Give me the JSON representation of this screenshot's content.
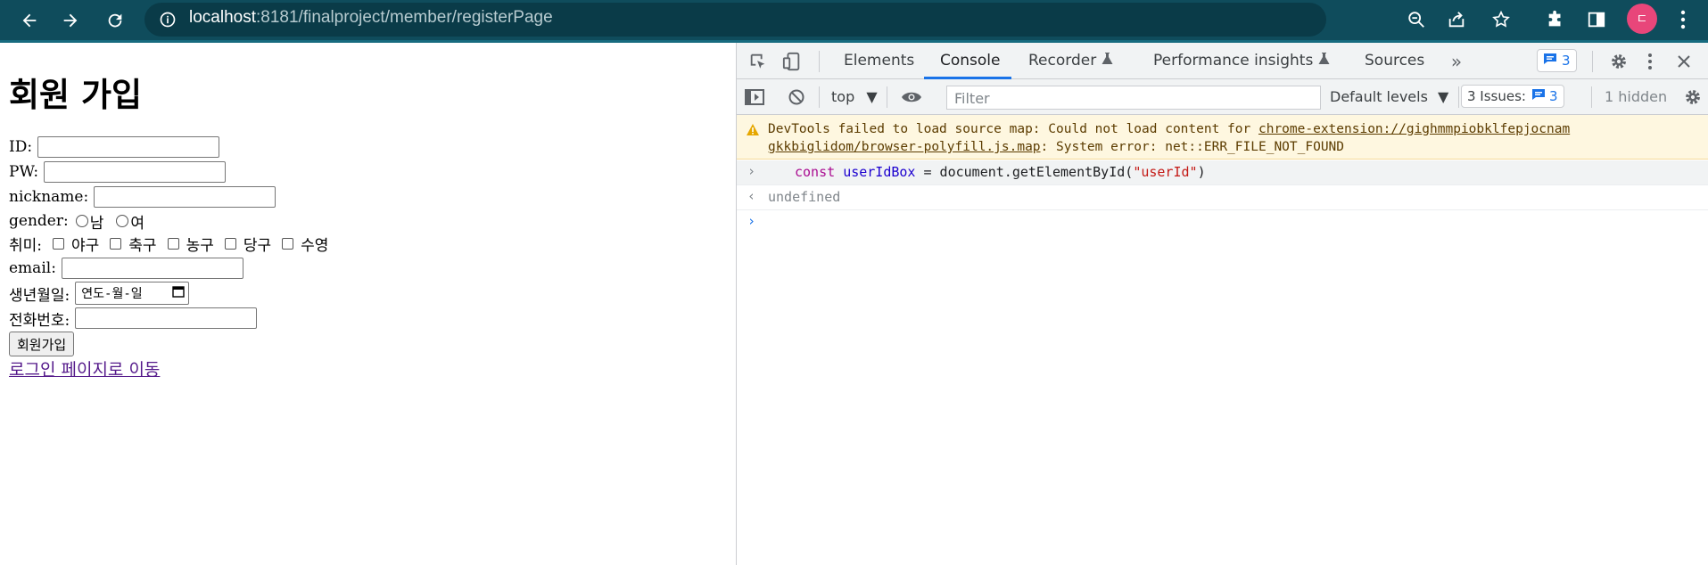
{
  "browser": {
    "url_host": "localhost",
    "url_rest": ":8181/finalproject/member/registerPage",
    "avatar_letter": "ㄷ",
    "colors": {
      "toolbar": "#0f4c5c",
      "avatar": "#e8467a"
    },
    "icons": [
      "back-arrow-icon",
      "forward-arrow-icon",
      "reload-icon",
      "site-info-icon",
      "zoom-icon",
      "share-icon",
      "bookmark-star-icon",
      "extensions-puzzle-icon",
      "side-panel-icon",
      "kebab-menu-icon"
    ]
  },
  "page": {
    "title": "회원 가입",
    "id_label": "ID:",
    "pw_label": "PW:",
    "nickname_label": "nickname:",
    "gender_label": "gender:",
    "gender_options": [
      "남",
      "여"
    ],
    "hobby_label": "취미:",
    "hobbies": [
      "야구",
      "축구",
      "농구",
      "당구",
      "수영"
    ],
    "email_label": "email:",
    "birth_label": "생년월일:",
    "birth_placeholder": "연도-월-일",
    "phone_label": "전화번호:",
    "submit_label": "회원가입",
    "login_link": "로그인 페이지로 이동"
  },
  "devtools": {
    "tabs": [
      "Elements",
      "Console",
      "Recorder",
      "Performance insights",
      "Sources"
    ],
    "active_tab": "Console",
    "issues_badge_count": "3",
    "context": "top",
    "filter_placeholder": "Filter",
    "levels": "Default levels",
    "issues_text": "3 Issues:",
    "issues_count": "3",
    "hidden_text": "1 hidden",
    "warning": {
      "prefix": "DevTools failed to load source map: Could not load content for ",
      "link": "chrome-extension://gighmmpiobklfepjocnam gkkbiglidom/browser-polyfill.js.map",
      "suffix": ": System error: net::ERR_FILE_NOT_FOUND"
    },
    "console_input": {
      "keyword": "const",
      "variable": "userIdBox",
      "middle": " = document.getElementById(",
      "string": "\"userId\"",
      "end": ")"
    },
    "console_result": "undefined",
    "accent": "#1a73e8"
  }
}
